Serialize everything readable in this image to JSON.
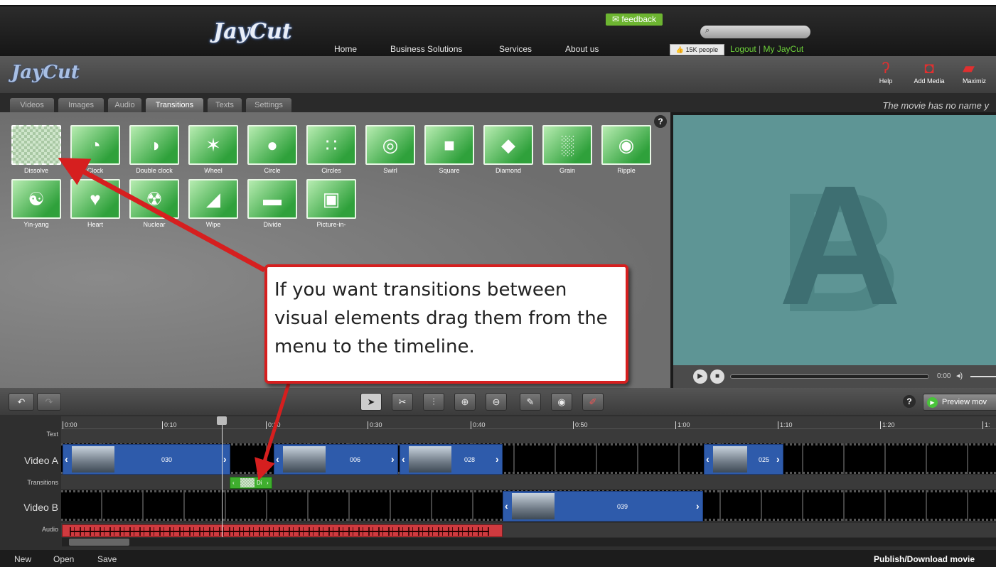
{
  "site": {
    "logo_text": "JayCut",
    "nav": [
      "Home",
      "Business Solutions",
      "Services",
      "About us"
    ],
    "feedback_label": "feedback",
    "like_label": "15K people",
    "logout_label": "Logout",
    "separator": "|",
    "my_label": "My JayCut"
  },
  "app": {
    "logo_text": "JayCut",
    "tools": [
      {
        "label": "Help",
        "icon": "help-icon"
      },
      {
        "label": "Add Media",
        "icon": "add-media-icon"
      },
      {
        "label": "Maximiz",
        "icon": "maximize-icon"
      }
    ],
    "tabs": [
      "Videos",
      "Images",
      "Audio",
      "Transitions",
      "Texts",
      "Settings"
    ],
    "active_tab": "Transitions",
    "movie_name_text": "The movie has no name y"
  },
  "transitions": [
    "Dissolve",
    "Clock",
    "Double clock",
    "Wheel",
    "Circle",
    "Circles",
    "Swirl",
    "Square",
    "Diamond",
    "Grain",
    "Ripple",
    "Yin-yang",
    "Heart",
    "Nuclear",
    "Wipe",
    "Divide",
    "Picture-in-"
  ],
  "help_glyph": "?",
  "preview": {
    "letters": [
      "A",
      "B"
    ],
    "time": "0:00"
  },
  "toolbar": {
    "preview_label": "Preview mov"
  },
  "timeline": {
    "ticks": [
      "0:00",
      "0:10",
      "0:20",
      "0:30",
      "0:40",
      "0:50",
      "1:00",
      "1:10",
      "1:20",
      "1:"
    ],
    "tracks": [
      "Text",
      "Video A",
      "Transitions",
      "Video B",
      "Audio"
    ],
    "video_a_clips": [
      "030",
      "006",
      "028",
      "025"
    ],
    "video_b_clips": [
      "039"
    ],
    "transition_clip_label": "Di"
  },
  "bottom": {
    "new_label": "New",
    "open_label": "Open",
    "save_label": "Save",
    "publish_label": "Publish/Download movie"
  },
  "callout": {
    "text": "If you want transitions between visual elements drag them from the menu to the timeline."
  },
  "colors": {
    "accent_green": "#6db531",
    "callout_red": "#d61f1f",
    "clip_blue": "#2e5bab",
    "audio_red": "#cf3a3f"
  }
}
